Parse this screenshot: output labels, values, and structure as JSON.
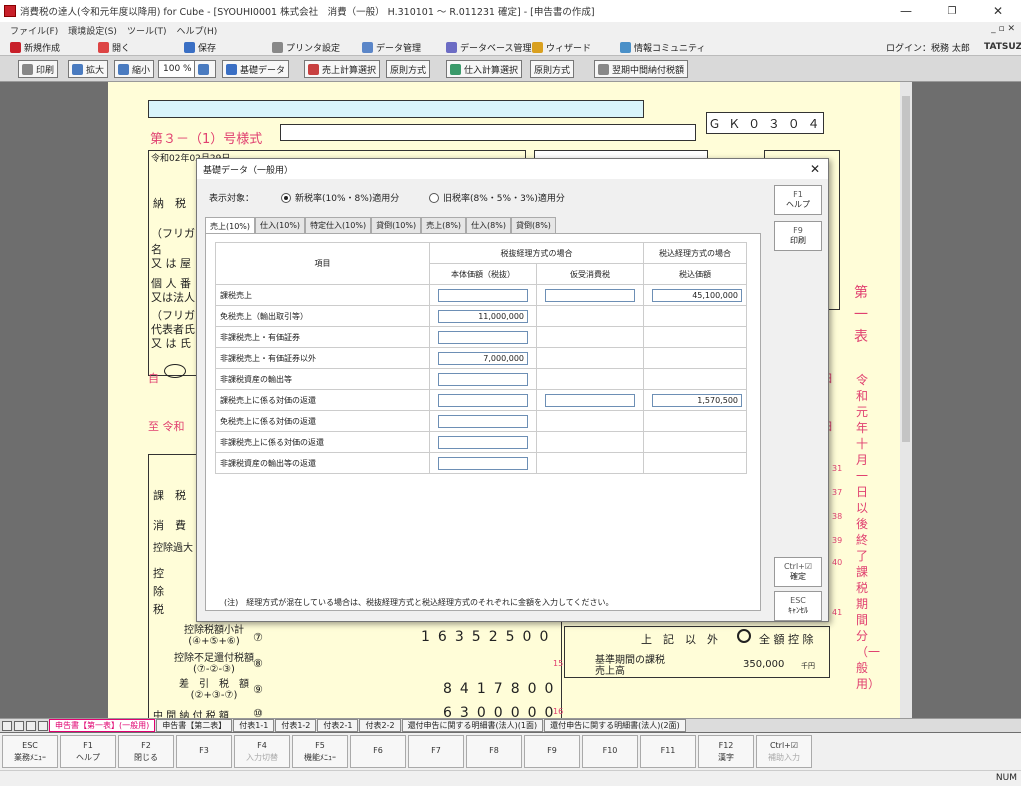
{
  "window": {
    "title": "消費税の達人(令和元年度以降用) for Cube - [SYOUHI0001 株式会社　消費（一般） H.310101 ～ R.011231 確定] - [申告書の作成]",
    "minimize": "—",
    "maximize": "❐",
    "close": "✕"
  },
  "menu": {
    "items": [
      "ファイル(F)",
      "環境設定(S)",
      "ツール(T)",
      "ヘルプ(H)"
    ],
    "mdi_controls": "_ ▫ ✕"
  },
  "toolbar1": {
    "new": "新規作成",
    "open": "開く",
    "save": "保存",
    "printer": "プリンタ設定",
    "data_mgmt": "データ管理",
    "db_mgmt": "データベース管理",
    "wizard": "ウィザード",
    "community": "情報コミュニティ",
    "login": "ログイン：税務 太郎",
    "brand": "TATSUZ"
  },
  "toolbar2": {
    "print": "印刷",
    "zoom_in": "拡大",
    "zoom_out": "縮小",
    "zoom_value": "100 %",
    "base_data": "基礎データ",
    "sales_calc": "売上計算選択",
    "rule1": "原則方式",
    "purchase_calc": "仕入計算選択",
    "rule2": "原則方式",
    "interim": "翌期中間納付税額"
  },
  "form": {
    "title": "第３－（1）号様式",
    "code": "Ｇ Ｋ ０ ３ ０ ４",
    "date": "令和02年02月29日",
    "row_nozei": "納　税",
    "row_furigana": "（フリガ",
    "row_name": "名",
    "row_name2": "又 は 屋",
    "row_kojin": "個 人 番",
    "row_kojin2": "又は法人",
    "row_furigana2": "（フリガ",
    "row_daihyo": "代表者氏",
    "row_daihyo2": "又 は 氏",
    "from_label": "自",
    "to_label": "至 令和",
    "side_first": "第 一 表",
    "side_text": "令和元年十月一日以後終了課税期間分（一般用）",
    "row_kazei": "課　税",
    "row_shohi": "消　費",
    "row_kojo": "控除過大",
    "row_kojo2": "控",
    "row_kojo3": "除",
    "row_kojo4": "税",
    "row_kojo_subtotal": "控除税額小計",
    "row_kojo_sub_formula": "(④+⑤+⑥)",
    "row_fusoku": "控除不足還付税額",
    "row_fusoku_formula": "(⑦-②-③)",
    "row_sashihiki": "差　引　税　額",
    "row_sashihiki_formula": "(②+③-⑦)",
    "row_chukan": "中 間 納 付 税 額",
    "num7": "⑦",
    "num8": "⑧",
    "num9": "⑨",
    "num10": "⑩",
    "digits7": [
      "1",
      "6",
      "3",
      "5",
      "2",
      "5",
      "0",
      "0"
    ],
    "digits9": [
      "8",
      "4",
      "1",
      "7",
      "8",
      "0",
      "0"
    ],
    "digits10": [
      "6",
      "3",
      "0",
      "0",
      "0",
      "0",
      "0"
    ],
    "right_label1": "上　記　以　外",
    "right_label2": "全 額 控 除",
    "right_label3": "基準期間の課税売上高",
    "right_value": "350,000",
    "right_unit": "千円",
    "side_nums": [
      "31",
      "37",
      "38",
      "39",
      "40",
      "41"
    ],
    "row_nums": [
      "15",
      "16"
    ]
  },
  "dialog": {
    "title": "基礎データ（一般用）",
    "close": "✕",
    "display_label": "表示対象：",
    "radio1": "新税率(10%・8%)適用分",
    "radio2": "旧税率(8%・5%・3%)適用分",
    "tabs": [
      "売上(10%)",
      "仕入(10%)",
      "特定仕入(10%)",
      "貸倒(10%)",
      "売上(8%)",
      "仕入(8%)",
      "貸倒(8%)"
    ],
    "header_item": "項目",
    "header_group1": "税抜経理方式の場合",
    "header_group2": "税込経理方式の場合",
    "header_sub1": "本体価額（税抜）",
    "header_sub2": "仮受消費税",
    "header_sub3": "税込価額",
    "rows": [
      {
        "label": "課税売上",
        "v1": "",
        "v2": "",
        "v3": "45,100,000"
      },
      {
        "label": "免税売上（輸出取引等）",
        "v1": "11,000,000",
        "v2": null,
        "v3": null
      },
      {
        "label": "非課税売上・有価証券",
        "v1": "",
        "v2": null,
        "v3": null
      },
      {
        "label": "非課税売上・有価証券以外",
        "v1": "7,000,000",
        "v2": null,
        "v3": null
      },
      {
        "label": "非課税資産の輸出等",
        "v1": "",
        "v2": null,
        "v3": null
      },
      {
        "label": "課税売上に係る対価の返還",
        "v1": "",
        "v2": "",
        "v3": "1,570,500"
      },
      {
        "label": "免税売上に係る対価の返還",
        "v1": "",
        "v2": null,
        "v3": null
      },
      {
        "label": "非課税売上に係る対価の返還",
        "v1": "",
        "v2": null,
        "v3": null
      },
      {
        "label": "非課税資産の輸出等の返還",
        "v1": "",
        "v2": null,
        "v3": null
      }
    ],
    "note": "(注)　経理方式が混在している場合は、税抜経理方式と税込経理方式のそれぞれに金額を入力してください。",
    "side_buttons": [
      {
        "key": "F1",
        "label": "ヘルプ"
      },
      {
        "key": "F9",
        "label": "印刷"
      },
      {
        "key": "Ctrl+☑",
        "label": "確定"
      },
      {
        "key": "ESC",
        "label": "ｷｬﾝｾﾙ"
      }
    ]
  },
  "sheet_tabs": [
    "申告書【第一表】(一般用)",
    "申告書【第二表】",
    "付表1-1",
    "付表1-2",
    "付表2-1",
    "付表2-2",
    "還付申告に関する明細書(法人)(1面)",
    "還付申告に関する明細書(法人)(2面)"
  ],
  "fkeys": [
    {
      "key": "ESC",
      "label": "業務ﾒﾆｭｰ",
      "disabled": false
    },
    {
      "key": "F1",
      "label": "ヘルプ",
      "disabled": false
    },
    {
      "key": "F2",
      "label": "閉じる",
      "disabled": false
    },
    {
      "key": "F3",
      "label": "",
      "disabled": true
    },
    {
      "key": "F4",
      "label": "入力切替",
      "disabled": true
    },
    {
      "key": "F5",
      "label": "機能ﾒﾆｭｰ",
      "disabled": false
    },
    {
      "key": "F6",
      "label": "",
      "disabled": true
    },
    {
      "key": "F7",
      "label": "",
      "disabled": true
    },
    {
      "key": "F8",
      "label": "",
      "disabled": true
    },
    {
      "key": "F9",
      "label": "",
      "disabled": true
    },
    {
      "key": "F10",
      "label": "",
      "disabled": true
    },
    {
      "key": "F11",
      "label": "",
      "disabled": true
    },
    {
      "key": "F12",
      "label": "漢字",
      "disabled": false
    },
    {
      "key": "Ctrl+☑",
      "label": "補助入力",
      "disabled": true
    }
  ],
  "status": {
    "num": "NUM"
  },
  "colors": {
    "form_bg": "#fffdd8",
    "accent_pink": "#e04070",
    "field_border": "#6d8fb5",
    "work_bg": "#6e6e6e"
  }
}
